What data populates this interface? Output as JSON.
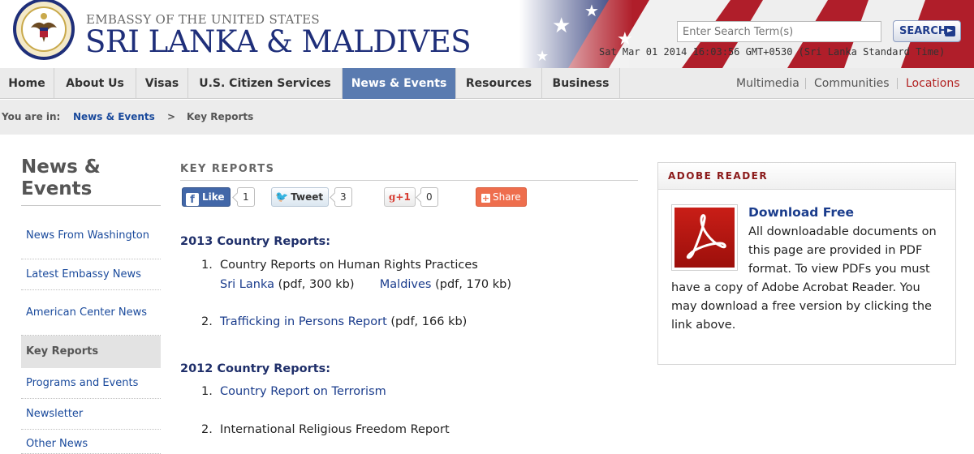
{
  "header": {
    "embassy_small": "EMBASSY OF THE UNITED STATES",
    "embassy_big": "SRI LANKA & MALDIVES",
    "search_placeholder": "Enter Search Term(s)",
    "search_button": "SEARCH",
    "datetime": "Sat Mar 01 2014 16:03:56 GMT+0530 (Sri Lanka Standard Time)"
  },
  "nav": {
    "items": [
      {
        "label": "Home"
      },
      {
        "label": "About Us"
      },
      {
        "label": "Visas"
      },
      {
        "label": "U.S. Citizen Services"
      },
      {
        "label": "News & Events"
      },
      {
        "label": "Resources"
      },
      {
        "label": "Business"
      }
    ],
    "right": [
      {
        "label": "Multimedia"
      },
      {
        "label": "Communities"
      },
      {
        "label": "Locations"
      }
    ]
  },
  "breadcrumb": {
    "prefix": "You are in:",
    "link": "News & Events",
    "sep": ">",
    "current": "Key Reports"
  },
  "sidebar": {
    "title": "News & Events",
    "items": [
      {
        "label": "News From Washington"
      },
      {
        "label": "Latest Embassy News"
      },
      {
        "label": "American Center News"
      },
      {
        "label": "Key Reports"
      },
      {
        "label": "Programs and Events"
      },
      {
        "label": "Newsletter"
      },
      {
        "label": "Other News"
      }
    ]
  },
  "main": {
    "heading": "KEY REPORTS",
    "social": {
      "like": "Like",
      "like_count": "1",
      "tweet": "Tweet",
      "tweet_count": "3",
      "gplus": "+1",
      "gplus_count": "0",
      "share": "Share"
    },
    "sections": [
      {
        "year": "2013 Country Reports:",
        "items": [
          {
            "num": "1.",
            "text": "Country Reports on Human Rights Practices",
            "sub": [
              {
                "link": "Sri Lanka",
                "note": "(pdf, 300 kb)"
              },
              {
                "link": "Maldives",
                "note": "(pdf, 170 kb)"
              }
            ]
          },
          {
            "num": "2.",
            "link": "Trafficking in Persons Report",
            "note": "(pdf, 166 kb)"
          }
        ]
      },
      {
        "year": "2012 Country Reports:",
        "items": [
          {
            "num": "1.",
            "link": "Country Report on Terrorism"
          },
          {
            "num": "2.",
            "text": "International Religious Freedom Report"
          }
        ]
      }
    ]
  },
  "adobe": {
    "title": "ADOBE READER",
    "link": "Download Free",
    "text": "All downloadable documents on this page are provided in PDF format.  To view PDFs you must have a copy of Adobe Acrobat Reader.  You may download a free version by clicking the link above."
  },
  "colors": {
    "brand_blue": "#1f2f7a",
    "nav_active": "#5a7bb0",
    "link": "#1a3c8c",
    "accent_red": "#8b1a1a"
  }
}
